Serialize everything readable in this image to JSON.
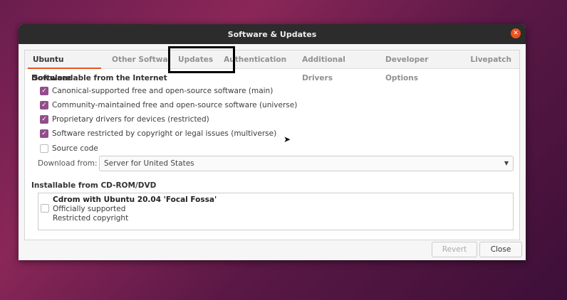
{
  "window": {
    "title": "Software & Updates"
  },
  "tabs": [
    {
      "label": "Ubuntu Software"
    },
    {
      "label": "Other Software"
    },
    {
      "label": "Updates"
    },
    {
      "label": "Authentication"
    },
    {
      "label": "Additional Drivers"
    },
    {
      "label": "Developer Options"
    },
    {
      "label": "Livepatch"
    }
  ],
  "internet": {
    "heading": "Downloadable from the Internet",
    "options": [
      {
        "label": "Canonical-supported free and open-source software (main)",
        "checked": true
      },
      {
        "label": "Community-maintained free and open-source software (universe)",
        "checked": true
      },
      {
        "label": "Proprietary drivers for devices (restricted)",
        "checked": true
      },
      {
        "label": "Software restricted by copyright or legal issues (multiverse)",
        "checked": true
      },
      {
        "label": "Source code",
        "checked": false
      }
    ],
    "download_label": "Download from:",
    "download_value": "Server for United States"
  },
  "cdrom": {
    "heading": "Installable from CD-ROM/DVD",
    "title": "Cdrom with Ubuntu 20.04 'Focal Fossa'",
    "line1": "Officially supported",
    "line2": "Restricted copyright"
  },
  "buttons": {
    "revert": "Revert",
    "close": "Close"
  },
  "colors": {
    "accent": "#e95420",
    "check": "#924d8b"
  }
}
